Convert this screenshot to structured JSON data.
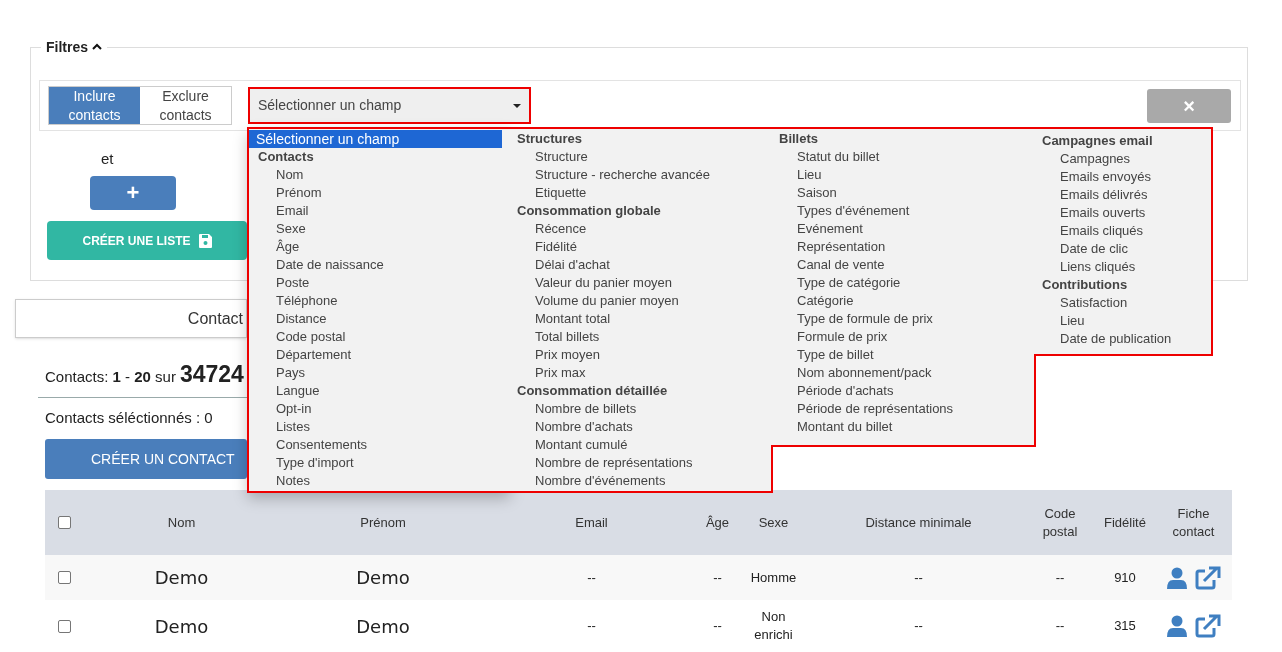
{
  "filters": {
    "title": "Filtres",
    "expanded": true,
    "mode_toggle": [
      {
        "label": "Inclure contacts",
        "selected": true
      },
      {
        "label": "Exclure contacts",
        "selected": false
      }
    ],
    "field_select": {
      "value": "Sélectionner un champ"
    },
    "conjunction": "et",
    "add_button": "+",
    "create_list_button": "CRÉER UNE LISTE",
    "remove_button": "×"
  },
  "field_dropdown": {
    "columns": [
      [
        {
          "kind": "placeholder",
          "label": "Sélectionner un champ",
          "selected": true
        },
        {
          "kind": "group",
          "label": "Contacts"
        },
        {
          "kind": "option",
          "label": "Nom",
          "selected": false
        },
        {
          "kind": "option",
          "label": "Prénom",
          "selected": false
        },
        {
          "kind": "option",
          "label": "Email",
          "selected": false
        },
        {
          "kind": "option",
          "label": "Sexe",
          "selected": false
        },
        {
          "kind": "option",
          "label": "Âge",
          "selected": false
        },
        {
          "kind": "option",
          "label": "Date de naissance",
          "selected": false
        },
        {
          "kind": "option",
          "label": "Poste",
          "selected": false
        },
        {
          "kind": "option",
          "label": "Téléphone",
          "selected": false
        },
        {
          "kind": "option",
          "label": "Distance",
          "selected": false
        },
        {
          "kind": "option",
          "label": "Code postal",
          "selected": false
        },
        {
          "kind": "option",
          "label": "Département",
          "selected": false
        },
        {
          "kind": "option",
          "label": "Pays",
          "selected": false
        },
        {
          "kind": "option",
          "label": "Langue",
          "selected": false
        },
        {
          "kind": "option",
          "label": "Opt-in",
          "selected": false
        },
        {
          "kind": "option",
          "label": "Listes",
          "selected": false
        },
        {
          "kind": "option",
          "label": "Consentements",
          "selected": false
        },
        {
          "kind": "option",
          "label": "Type d'import",
          "selected": false
        },
        {
          "kind": "option",
          "label": "Notes",
          "selected": false
        }
      ],
      [
        {
          "kind": "group",
          "label": "Structures"
        },
        {
          "kind": "option",
          "label": "Structure",
          "selected": false
        },
        {
          "kind": "option",
          "label": "Structure - recherche avancée",
          "selected": false
        },
        {
          "kind": "option",
          "label": "Etiquette",
          "selected": false
        },
        {
          "kind": "group",
          "label": "Consommation globale"
        },
        {
          "kind": "option",
          "label": "Récence",
          "selected": false
        },
        {
          "kind": "option",
          "label": "Fidélité",
          "selected": false
        },
        {
          "kind": "option",
          "label": "Délai d'achat",
          "selected": false
        },
        {
          "kind": "option",
          "label": "Valeur du panier moyen",
          "selected": false
        },
        {
          "kind": "option",
          "label": "Volume du panier moyen",
          "selected": false
        },
        {
          "kind": "option",
          "label": "Montant total",
          "selected": false
        },
        {
          "kind": "option",
          "label": "Total billets",
          "selected": false
        },
        {
          "kind": "option",
          "label": "Prix moyen",
          "selected": false
        },
        {
          "kind": "option",
          "label": "Prix max",
          "selected": false
        },
        {
          "kind": "group",
          "label": "Consommation détaillée"
        },
        {
          "kind": "option",
          "label": "Nombre de billets",
          "selected": false
        },
        {
          "kind": "option",
          "label": "Nombre d'achats",
          "selected": false
        },
        {
          "kind": "option",
          "label": "Montant cumulé",
          "selected": false
        },
        {
          "kind": "option",
          "label": "Nombre de représentations",
          "selected": false
        },
        {
          "kind": "option",
          "label": "Nombre d'événements",
          "selected": false
        }
      ],
      [
        {
          "kind": "group",
          "label": "Billets"
        },
        {
          "kind": "option",
          "label": "Statut du billet",
          "selected": false
        },
        {
          "kind": "option",
          "label": "Lieu",
          "selected": false
        },
        {
          "kind": "option",
          "label": "Saison",
          "selected": false
        },
        {
          "kind": "option",
          "label": "Types d'événement",
          "selected": false
        },
        {
          "kind": "option",
          "label": "Evénement",
          "selected": false
        },
        {
          "kind": "option",
          "label": "Représentation",
          "selected": false
        },
        {
          "kind": "option",
          "label": "Canal de vente",
          "selected": false
        },
        {
          "kind": "option",
          "label": "Type de catégorie",
          "selected": false
        },
        {
          "kind": "option",
          "label": "Catégorie",
          "selected": false
        },
        {
          "kind": "option",
          "label": "Type de formule de prix",
          "selected": false
        },
        {
          "kind": "option",
          "label": "Formule de prix",
          "selected": false
        },
        {
          "kind": "option",
          "label": "Type de billet",
          "selected": false
        },
        {
          "kind": "option",
          "label": "Nom abonnement/pack",
          "selected": false
        },
        {
          "kind": "option",
          "label": "Période d'achats",
          "selected": false
        },
        {
          "kind": "option",
          "label": "Période de représentations",
          "selected": false
        },
        {
          "kind": "option",
          "label": "Montant du billet",
          "selected": false
        }
      ],
      [
        {
          "kind": "group",
          "label": "Campagnes email"
        },
        {
          "kind": "option",
          "label": "Campagnes",
          "selected": false
        },
        {
          "kind": "option",
          "label": "Emails envoyés",
          "selected": false
        },
        {
          "kind": "option",
          "label": "Emails délivrés",
          "selected": false
        },
        {
          "kind": "option",
          "label": "Emails ouverts",
          "selected": false
        },
        {
          "kind": "option",
          "label": "Emails cliqués",
          "selected": false
        },
        {
          "kind": "option",
          "label": "Date de clic",
          "selected": false
        },
        {
          "kind": "option",
          "label": "Liens cliqués",
          "selected": false
        },
        {
          "kind": "group",
          "label": "Contributions"
        },
        {
          "kind": "option",
          "label": "Satisfaction",
          "selected": false
        },
        {
          "kind": "option",
          "label": "Lieu",
          "selected": false
        },
        {
          "kind": "option",
          "label": "Date de publication",
          "selected": false
        }
      ]
    ]
  },
  "tab": "Contact",
  "summary": {
    "text": "Contacts: **1** - **20** sur",
    "total": "34724"
  },
  "selected_count": "Contacts séléctionnés : 0",
  "create_contact_button": "CRÉER UN CONTACT",
  "table": {
    "select_all_checked": false,
    "columns": [
      "Nom",
      "Prénom",
      "Email",
      "Âge",
      "Sexe",
      "Distance minimale",
      "Code postal",
      "Fidélité",
      "Fiche contact"
    ],
    "rows": [
      {
        "checked": false,
        "cells": [
          "Demo",
          "Demo",
          "--",
          "--",
          "Homme",
          "--",
          "--",
          "910"
        ]
      },
      {
        "checked": false,
        "cells": [
          "Demo",
          "Demo",
          "--",
          "--",
          "Non enrichi",
          "--",
          "--",
          "315"
        ]
      }
    ]
  }
}
